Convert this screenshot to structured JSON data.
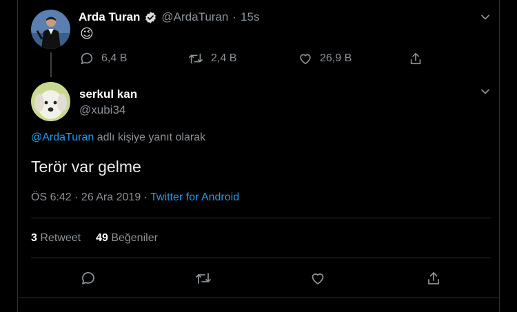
{
  "original_tweet": {
    "author_name": "Arda Turan",
    "handle": "@ArdaTuran",
    "separator": "·",
    "time": "15s",
    "text": "😉",
    "actions": {
      "reply_count": "6,4 B",
      "retweet_count": "2,4 B",
      "like_count": "26,9 B"
    }
  },
  "reply_tweet": {
    "author_name": "serkul kan",
    "handle": "@xubi34",
    "reply_to_handle": "@ArdaTuran",
    "reply_to_suffix": "adlı kişiye yanıt olarak",
    "text": "Terör var gelme",
    "timestamp": "ÖS 6:42 · 26 Ara 2019 · ",
    "source": "Twitter for Android",
    "stats": {
      "retweet_count": "3",
      "retweet_label": "Retweet",
      "like_count": "49",
      "like_label": "Beğeniler"
    }
  },
  "colors": {
    "background": "#000000",
    "text": "#d9d9d9",
    "muted": "#8b9298",
    "accent": "#1d9bf0",
    "verified": "#d9d9d9"
  },
  "icons": {
    "reply": "reply-icon",
    "retweet": "retweet-icon",
    "like": "heart-icon",
    "share": "share-icon",
    "more": "chevron-down-icon",
    "verified": "verified-badge-icon"
  }
}
